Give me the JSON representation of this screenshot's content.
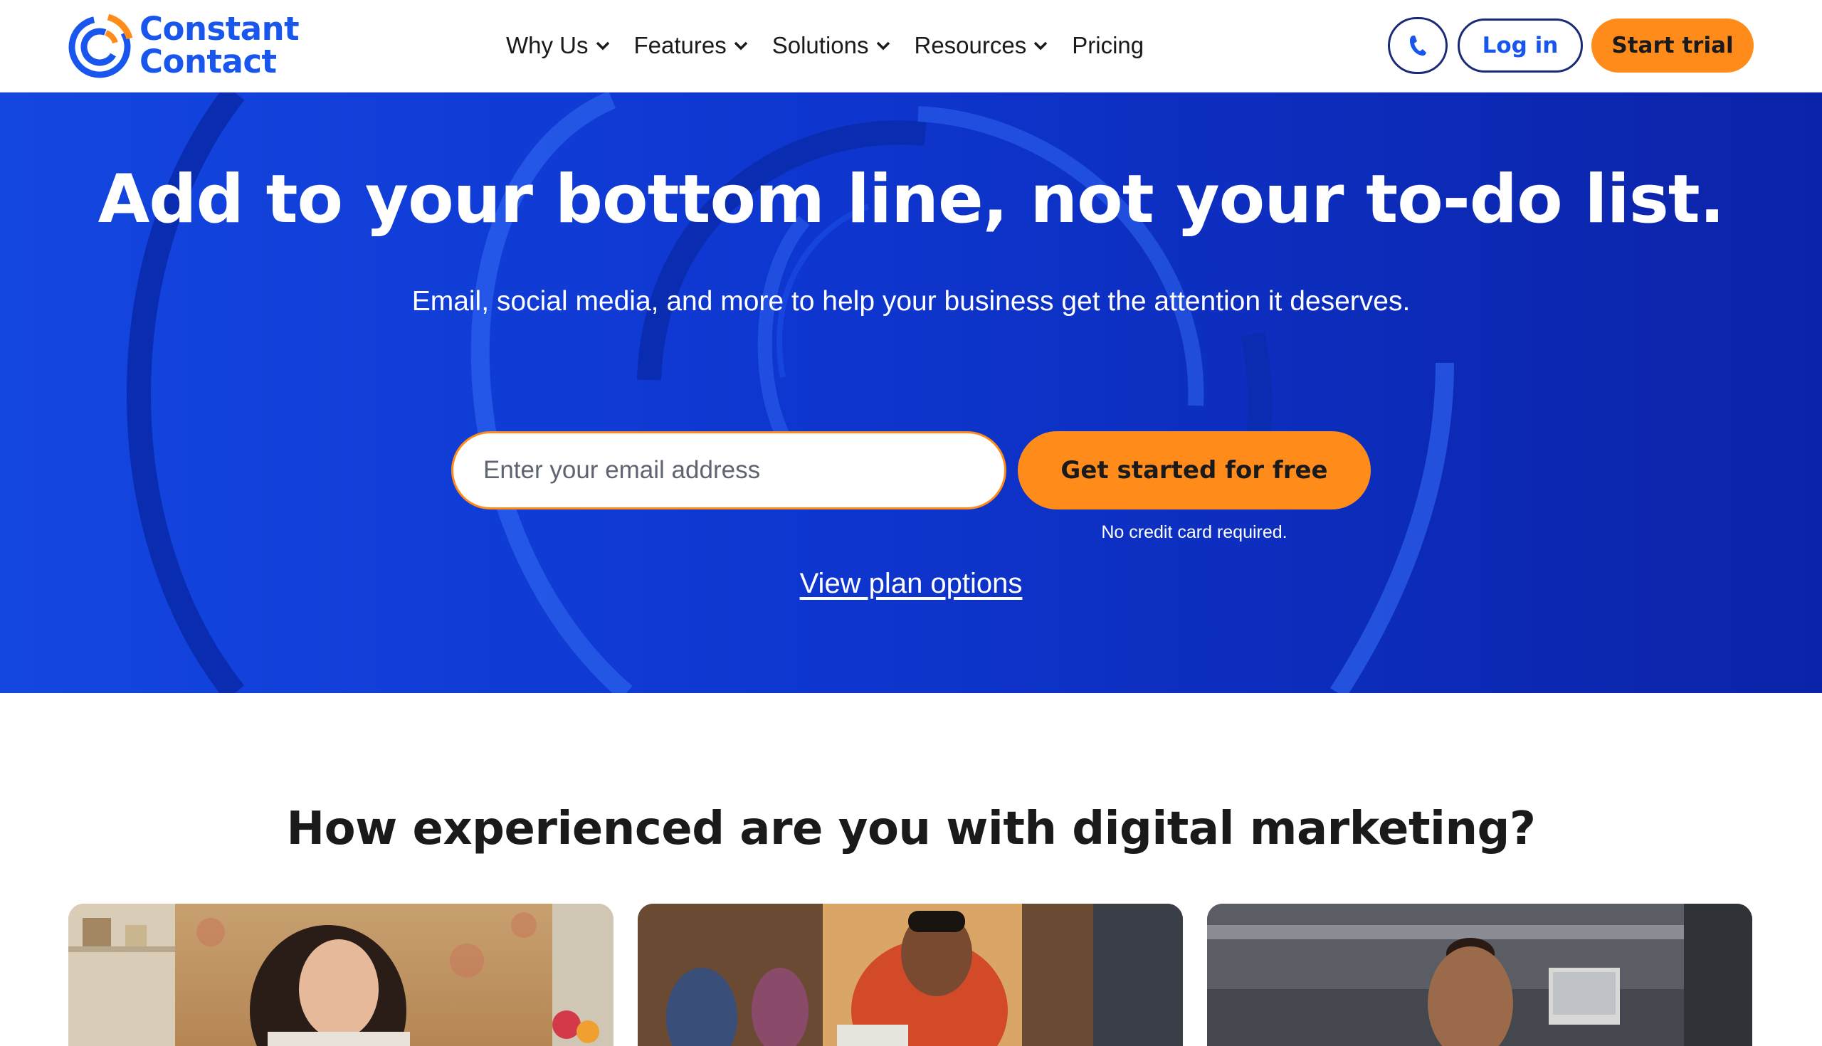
{
  "brand": {
    "name_line1": "Constant",
    "name_line2": "Contact",
    "color": "#1856ED",
    "accent": "#FF8C1A"
  },
  "nav": {
    "items": [
      {
        "label": "Why Us",
        "has_dropdown": true
      },
      {
        "label": "Features",
        "has_dropdown": true
      },
      {
        "label": "Solutions",
        "has_dropdown": true
      },
      {
        "label": "Resources",
        "has_dropdown": true
      },
      {
        "label": "Pricing",
        "has_dropdown": false
      }
    ],
    "phone_icon": "phone-icon",
    "login_label": "Log in",
    "trial_label": "Start trial"
  },
  "hero": {
    "title": "Add to your bottom line, not your to-do list.",
    "subtitle": "Email, social media, and more to help your business get the attention it deserves.",
    "email_placeholder": "Enter your email address",
    "email_value": "",
    "cta_label": "Get started for free",
    "disclaimer": "No credit card required.",
    "plan_link": "View plan options",
    "background_color": "#1043D8"
  },
  "experience": {
    "title": "How experienced are you with digital marketing?"
  }
}
